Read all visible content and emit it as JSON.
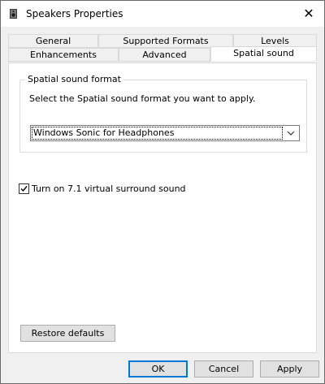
{
  "window": {
    "title": "Speakers Properties",
    "icon": "speaker-icon",
    "close_glyph": "✕"
  },
  "tabs_row1": [
    "General",
    "Supported Formats",
    "Levels"
  ],
  "tabs_row2": [
    "Enhancements",
    "Advanced",
    "Spatial sound"
  ],
  "selected_tab": "Spatial sound",
  "spatial": {
    "group_title": "Spatial sound format",
    "description": "Select the Spatial sound format you want to apply.",
    "selected_format": "Windows Sonic for Headphones"
  },
  "surround": {
    "label": "Turn on 7.1 virtual surround sound",
    "checked": true
  },
  "buttons": {
    "restore": "Restore defaults",
    "ok": "OK",
    "cancel": "Cancel",
    "apply": "Apply"
  },
  "colors": {
    "default_button_border": "#0078d7",
    "window_background": "#f0f0f0"
  }
}
